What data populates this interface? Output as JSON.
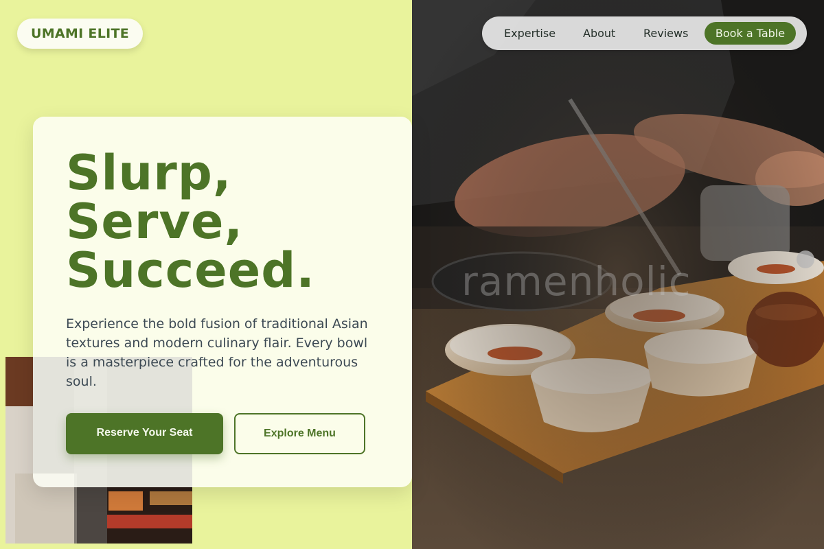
{
  "brand": {
    "logo_text": "UMAMI ELITE"
  },
  "nav": {
    "links": [
      "Expertise",
      "About",
      "Reviews"
    ],
    "cta_label": "Book a Table"
  },
  "hero": {
    "title_lines": [
      "Slurp,",
      "Serve,",
      "Succeed."
    ],
    "description": "Experience the bold fusion of traditional Asian textures and modern culinary flair. Every bowl is a masterpiece crafted for the adventurous soul.",
    "primary_button": "Reserve Your Seat",
    "secondary_button": "Explore Menu"
  },
  "images": {
    "hero_watermark": "ramenholic",
    "hero_photo": "chef-plating-dishes-photo",
    "collage_photo": "restaurant-interior-photo"
  },
  "colors": {
    "accent": "#4d7427",
    "left_background": "#e9f39c",
    "card_background": "#fdfef5"
  }
}
